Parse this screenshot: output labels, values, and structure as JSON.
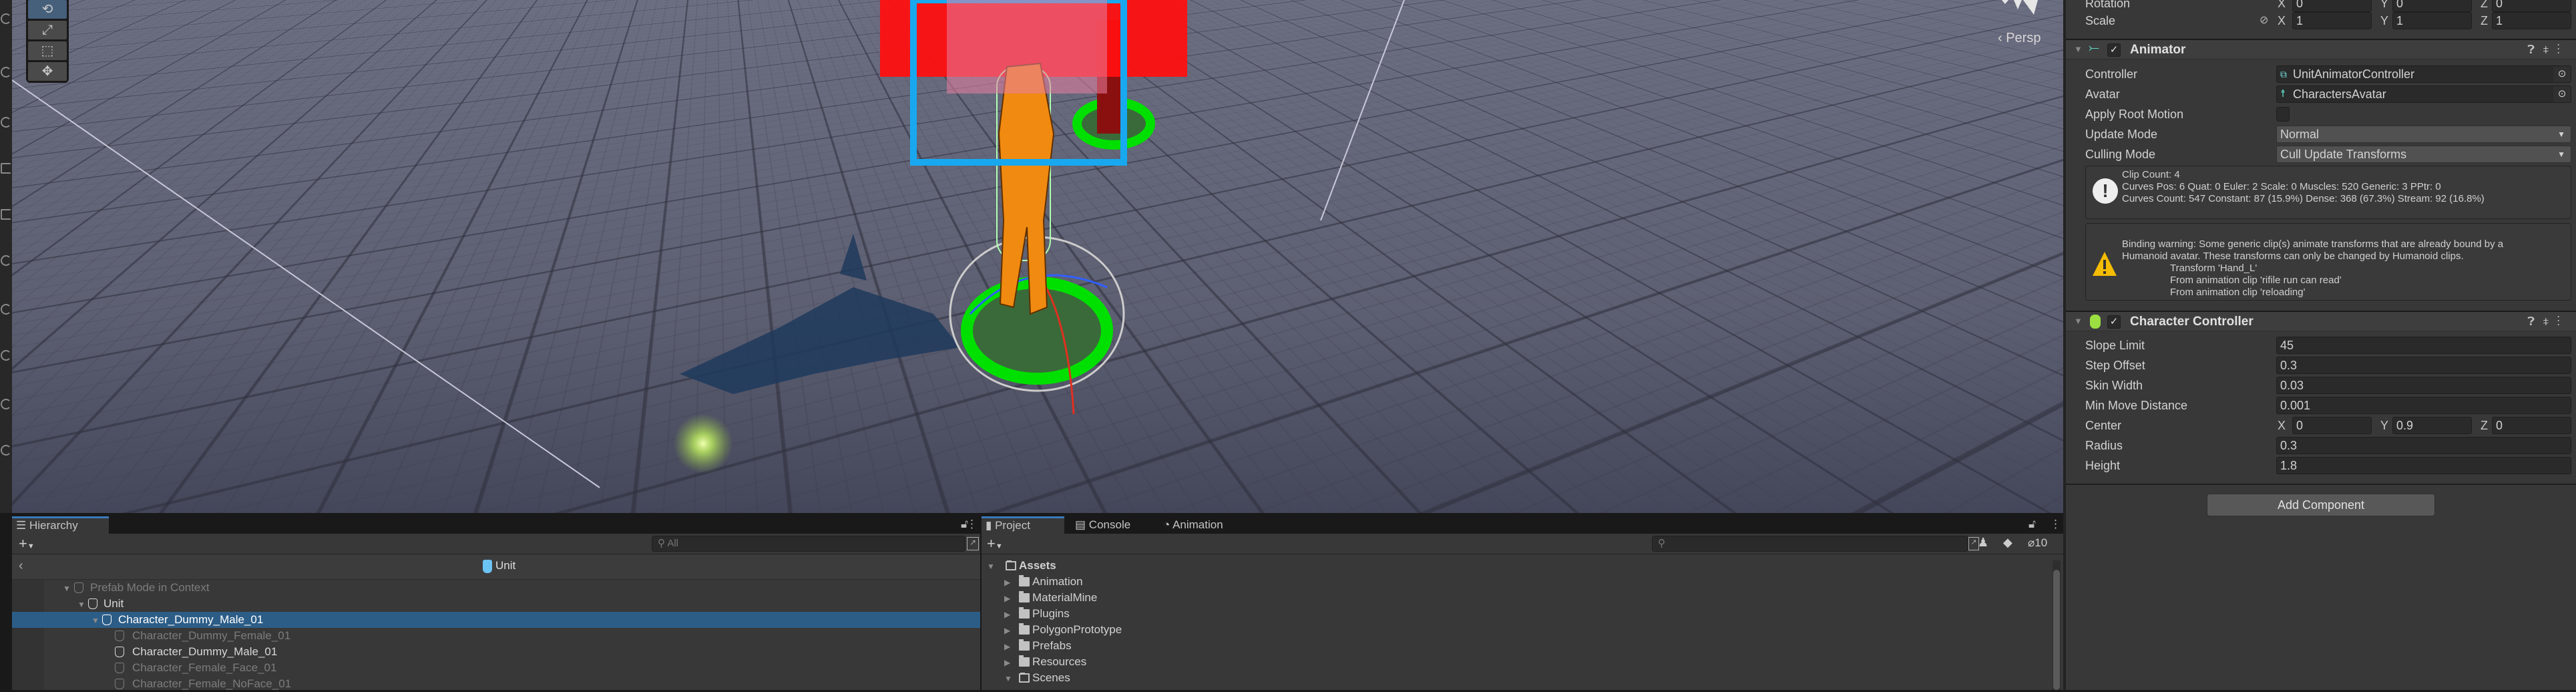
{
  "scene": {
    "view_mode": "Persp",
    "tools": [
      "rotate-tool",
      "scale-tool",
      "rect-tool",
      "transform-tool"
    ],
    "selected_tool": "rotate-tool"
  },
  "hierarchy": {
    "tab": "Hierarchy",
    "search_placeholder": "All",
    "breadcrumb": "Unit",
    "rows": [
      {
        "label": "Prefab Mode in Context",
        "depth": 0,
        "expanded": true,
        "dimmed": true
      },
      {
        "label": "Unit",
        "depth": 1,
        "expanded": true,
        "dimmed": false
      },
      {
        "label": "Character_Dummy_Male_01",
        "depth": 2,
        "expanded": true,
        "selected": true
      },
      {
        "label": "Character_Dummy_Female_01",
        "depth": 3,
        "dimmed": true
      },
      {
        "label": "Character_Dummy_Male_01",
        "depth": 3,
        "dimmed": false
      },
      {
        "label": "Character_Female_Face_01",
        "depth": 3,
        "dimmed": true
      },
      {
        "label": "Character_Female_NoFace_01",
        "depth": 3,
        "dimmed": true
      }
    ]
  },
  "project": {
    "tabs": [
      "Project",
      "Console",
      "Animation"
    ],
    "hidden_count": "10",
    "root": "Assets",
    "folders": [
      "Animation",
      "MaterialMine",
      "Plugins",
      "PolygonPrototype",
      "Prefabs",
      "Resources",
      "Scenes"
    ]
  },
  "inspector": {
    "axes": [
      "X",
      "Y",
      "Z"
    ],
    "rotation": {
      "label": "Rotation",
      "x": "0",
      "y": "0",
      "z": "0"
    },
    "scale": {
      "label": "Scale",
      "x": "1",
      "y": "1",
      "z": "1"
    },
    "animator": {
      "title": "Animator",
      "enabled": true,
      "controller": {
        "label": "Controller",
        "value": "UnitAnimatorController"
      },
      "avatar": {
        "label": "Avatar",
        "value": "CharactersAvatar"
      },
      "apply_root_motion": {
        "label": "Apply Root Motion",
        "checked": false
      },
      "update_mode": {
        "label": "Update Mode",
        "value": "Normal"
      },
      "culling_mode": {
        "label": "Culling Mode",
        "value": "Cull Update Transforms"
      },
      "info": [
        "Clip Count: 4",
        "Curves Pos: 6 Quat: 0 Euler: 2 Scale: 0 Muscles: 520 Generic: 3 PPtr: 0",
        "Curves Count: 547 Constant: 87 (15.9%) Dense: 368 (67.3%) Stream: 92 (16.8%)"
      ],
      "warning": [
        "Binding warning: Some generic clip(s) animate transforms that are already bound by a",
        "Humanoid avatar. These transforms can only be changed by Humanoid clips.",
        "Transform 'Hand_L'",
        "From animation clip 'rifile run can read'",
        "From animation clip 'reloading'"
      ]
    },
    "character_controller": {
      "title": "Character Controller",
      "enabled": true,
      "slope_limit": {
        "label": "Slope Limit",
        "value": "45"
      },
      "step_offset": {
        "label": "Step Offset",
        "value": "0.3"
      },
      "skin_width": {
        "label": "Skin Width",
        "value": "0.03"
      },
      "min_move_distance": {
        "label": "Min Move Distance",
        "value": "0.001"
      },
      "center": {
        "label": "Center",
        "x": "0",
        "y": "0.9",
        "z": "0"
      },
      "radius": {
        "label": "Radius",
        "value": "0.3"
      },
      "height": {
        "label": "Height",
        "value": "1.8"
      }
    },
    "add_component": "Add Component"
  },
  "colors": {
    "selection": "#2c5d87",
    "accent": "#3a79bb",
    "warning": "#f4bc02",
    "ring": "#00e000"
  }
}
